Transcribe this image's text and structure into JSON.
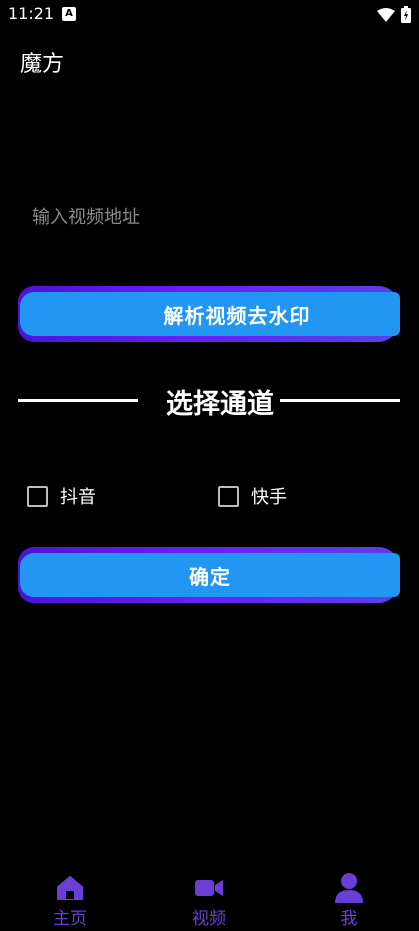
{
  "status_bar": {
    "time": "11:21",
    "app_icon_letter": "A"
  },
  "app": {
    "title": "魔方"
  },
  "url_input": {
    "placeholder": "输入视频地址",
    "value": ""
  },
  "parse_button": {
    "label": "解析视频去水印"
  },
  "channel_section": {
    "title": "选择通道",
    "options": [
      {
        "label": "抖音",
        "checked": false
      },
      {
        "label": "快手",
        "checked": false
      }
    ]
  },
  "confirm_button": {
    "label": "确定"
  },
  "bottom_nav": {
    "items": [
      {
        "label": "主页",
        "icon": "home-icon"
      },
      {
        "label": "视频",
        "icon": "video-camera-icon"
      },
      {
        "label": "我",
        "icon": "person-icon"
      }
    ]
  },
  "colors": {
    "background": "#000000",
    "button_blue": "#2196f3",
    "button_purple": "#5a1ee8",
    "nav_accent": "#6a3fd6"
  }
}
